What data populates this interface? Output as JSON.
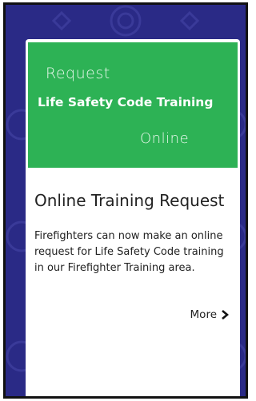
{
  "colors": {
    "frame_background": "#2a2a86",
    "banner_green": "#2db255",
    "card_background": "#ffffff"
  },
  "banner": {
    "line1": "Request",
    "line2": "Life Safety Code Training",
    "line3": "Online"
  },
  "card": {
    "title": "Online Training Request",
    "body": "Firefighters can now make an online request for Life Safety Code training in our Firefighter Training area.",
    "more_label": "More",
    "more_icon": "chevron-right-icon"
  }
}
